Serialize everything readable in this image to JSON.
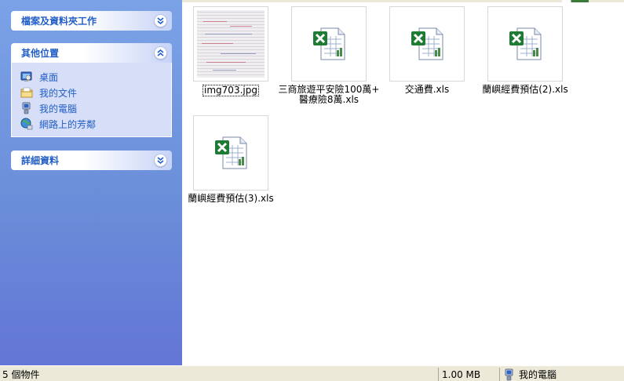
{
  "taskpane": {
    "file_tasks": {
      "title": "檔案及資料夾工作"
    },
    "other_places": {
      "title": "其他位置",
      "items": [
        {
          "label": "桌面",
          "icon": "desktop-icon"
        },
        {
          "label": "我的文件",
          "icon": "my-documents-icon"
        },
        {
          "label": "我的電腦",
          "icon": "my-computer-icon"
        },
        {
          "label": "網路上的芳鄰",
          "icon": "network-places-icon"
        }
      ]
    },
    "details": {
      "title": "詳細資料"
    }
  },
  "files": [
    {
      "name": "img703.jpg",
      "type": "jpg",
      "selected": true
    },
    {
      "name": "三商旅遊平安險100萬+\n醫療險8萬.xls",
      "type": "xls"
    },
    {
      "name": "交通費.xls",
      "type": "xls"
    },
    {
      "name": "蘭嶼經費預估(2).xls",
      "type": "xls"
    },
    {
      "name": "蘭嶼經費預估(3).xls",
      "type": "xls"
    }
  ],
  "statusbar": {
    "count": "5 個物件",
    "size": "1.00 MB",
    "location": "我的電腦"
  },
  "colors": {
    "pane_link": "#215dc6",
    "pane_gradient_top": "#7ba2e7",
    "pane_gradient_bottom": "#6375d6",
    "excel_green": "#1e7b34"
  }
}
